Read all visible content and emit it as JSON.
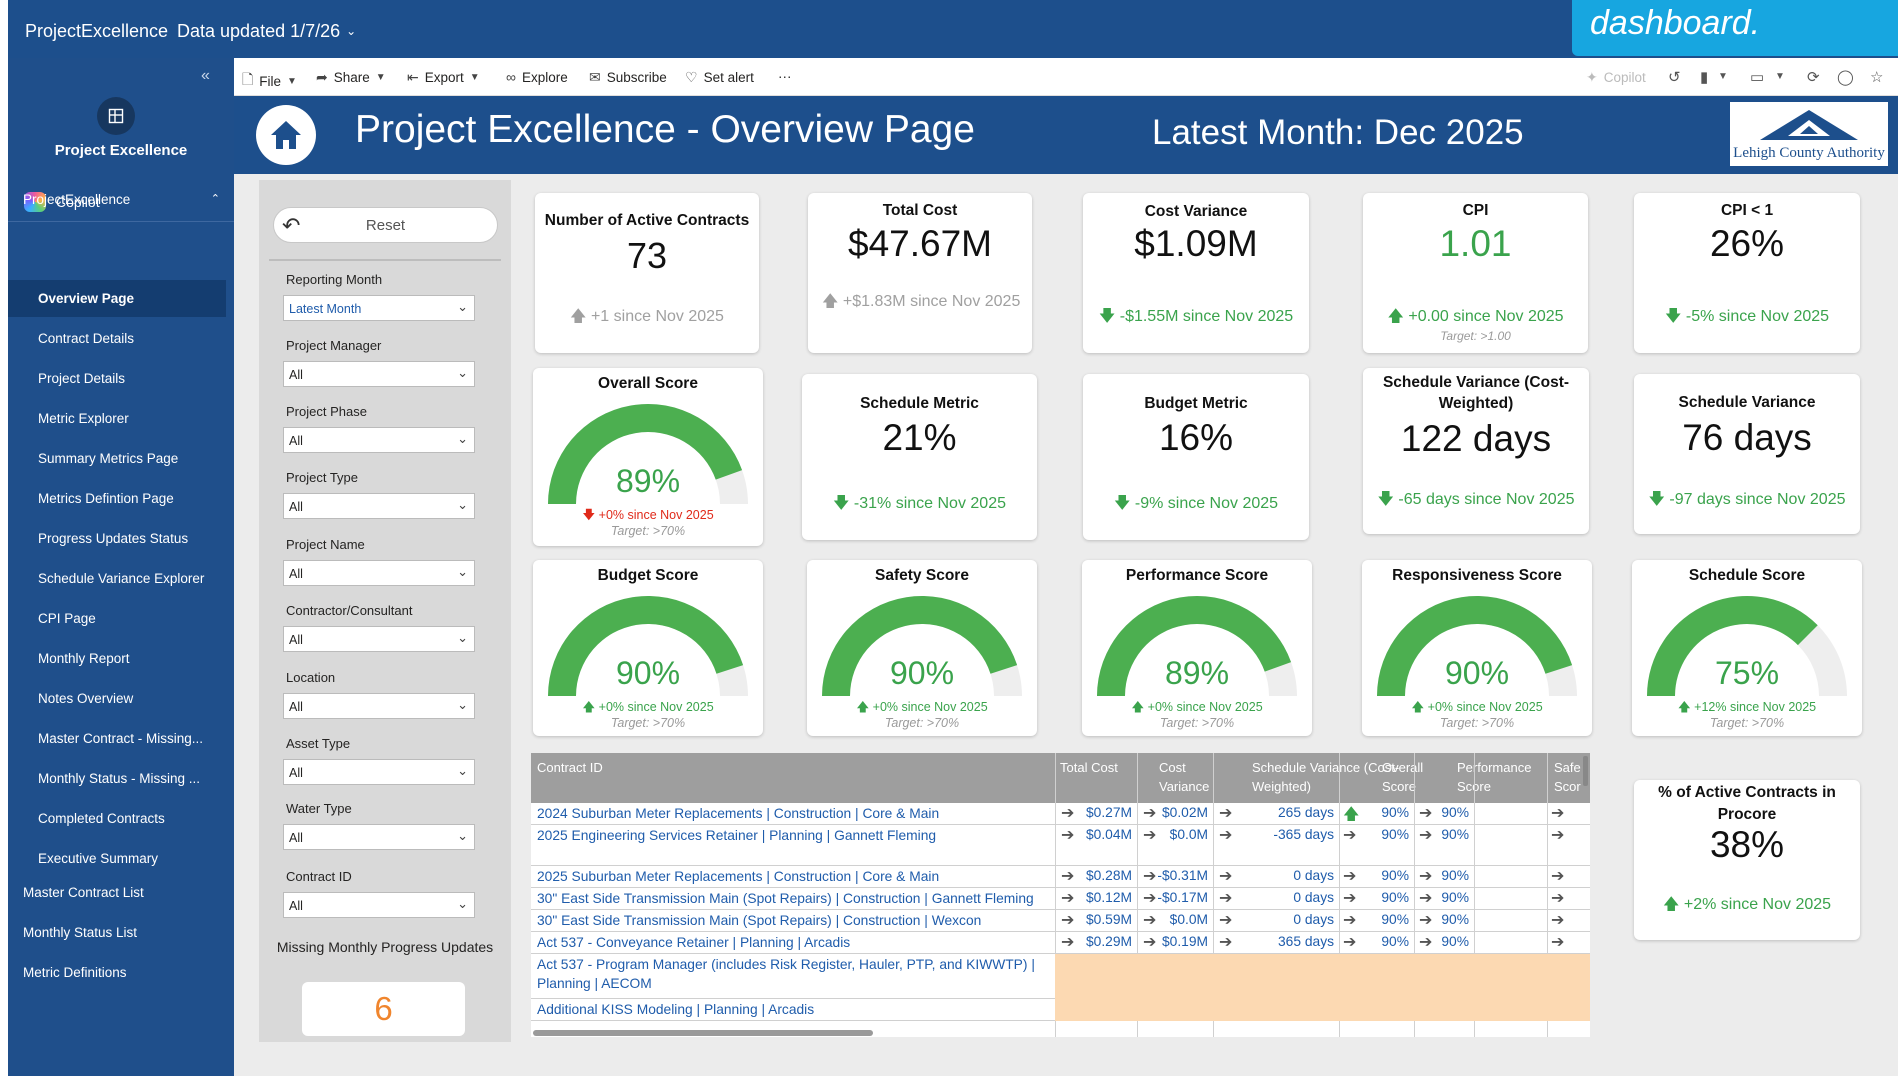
{
  "topbar": {
    "app_name": "ProjectExcellence",
    "data_updated": "Data updated 1/7/26"
  },
  "callout": {
    "text": "dashboard."
  },
  "leftnav": {
    "workspace_name": "Project Excellence",
    "copilot": "Copilot",
    "section": "ProjectExcellence",
    "items": [
      "Overview Page",
      "Contract Details",
      "Project Details",
      "Metric Explorer",
      "Summary Metrics Page",
      "Metrics Defintion Page",
      "Progress Updates Status",
      "Schedule Variance Explorer",
      "CPI Page",
      "Monthly Report",
      "Notes Overview",
      "Master Contract - Missing...",
      "Monthly Status - Missing ...",
      "Completed Contracts",
      "Executive Summary"
    ],
    "active_item": "Overview Page",
    "root_items": [
      "Master Contract List",
      "Monthly Status List",
      "Metric Definitions"
    ]
  },
  "toolbar": {
    "file": "File",
    "share": "Share",
    "export": "Export",
    "explore": "Explore",
    "subscribe": "Subscribe",
    "set_alert": "Set alert",
    "more": "···",
    "copilot": "Copilot"
  },
  "header": {
    "title": "Project Excellence - Overview Page",
    "latest_month": "Latest Month: Dec 2025",
    "logo_text": "Lehigh County Authority"
  },
  "filters": {
    "reset": "Reset",
    "slicers": [
      {
        "label": "Reporting Month",
        "value": "Latest Month"
      },
      {
        "label": "Project Manager",
        "value": "All"
      },
      {
        "label": "Project Phase",
        "value": "All"
      },
      {
        "label": "Project Type",
        "value": "All"
      },
      {
        "label": "Project Name",
        "value": "All"
      },
      {
        "label": "Contractor/Consultant",
        "value": "All"
      },
      {
        "label": "Location",
        "value": "All"
      },
      {
        "label": "Asset Type",
        "value": "All"
      },
      {
        "label": "Water Type",
        "value": "All"
      },
      {
        "label": "Contract ID",
        "value": "All"
      }
    ],
    "missing_label": "Missing Monthly Progress Updates",
    "missing_value": "6"
  },
  "kpis": {
    "active_contracts": {
      "title": "Number of Active Contracts",
      "value": "73",
      "delta": "+1 since Nov 2025"
    },
    "total_cost": {
      "title": "Total Cost",
      "value": "$47.67M",
      "delta": "+$1.83M since Nov 2025"
    },
    "cost_variance": {
      "title": "Cost Variance",
      "value": "$1.09M",
      "delta": "-$1.55M since Nov 2025"
    },
    "cpi": {
      "title": "CPI",
      "value": "1.01",
      "delta": "+0.00 since Nov 2025",
      "target": "Target: >1.00"
    },
    "cpi_lt1": {
      "title": "CPI < 1",
      "value": "26%",
      "delta": "-5% since Nov 2025"
    },
    "schedule_metric": {
      "title": "Schedule Metric",
      "value": "21%",
      "delta": "-31% since Nov 2025"
    },
    "budget_metric": {
      "title": "Budget Metric",
      "value": "16%",
      "delta": "-9% since Nov 2025"
    },
    "sv_cost_weighted": {
      "title": "Schedule Variance (Cost-Weighted)",
      "value": "122 days",
      "delta": "-65 days since Nov 2025"
    },
    "schedule_variance": {
      "title": "Schedule Variance",
      "value": "76 days",
      "delta": "-97 days since Nov 2025"
    },
    "procore": {
      "title": "% of Active Contracts in Procore",
      "value": "38%",
      "delta": "+2% since Nov 2025"
    }
  },
  "gauges": [
    {
      "title": "Overall Score",
      "value": "89%",
      "fill": 0.89,
      "delta": "+0% since Nov 2025",
      "target": "Target: >70%"
    },
    {
      "title": "Budget Score",
      "value": "90%",
      "fill": 0.9,
      "delta": "+0% since Nov 2025",
      "target": "Target: >70%"
    },
    {
      "title": "Safety Score",
      "value": "90%",
      "fill": 0.9,
      "delta": "+0% since Nov 2025",
      "target": "Target: >70%"
    },
    {
      "title": "Performance Score",
      "value": "89%",
      "fill": 0.89,
      "delta": "+0% since Nov 2025",
      "target": "Target: >70%"
    },
    {
      "title": "Responsiveness Score",
      "value": "90%",
      "fill": 0.9,
      "delta": "+0% since Nov 2025",
      "target": "Target: >70%"
    },
    {
      "title": "Schedule Score",
      "value": "75%",
      "fill": 0.75,
      "delta": "+12% since Nov 2025",
      "target": "Target: >70%"
    }
  ],
  "colors": {
    "gauge_fill": "#4caf50",
    "gauge_track": "#eeeeee",
    "good": "#3aa34c",
    "bad": "#e02a1a",
    "header": "#1d4f8c"
  },
  "table": {
    "headers": [
      "Contract ID",
      "Total Cost",
      "Cost Variance",
      "Schedule Variance (Cost-Weighted)",
      "Overall Score",
      "Performance Score",
      "Safe Scor"
    ],
    "rows": [
      {
        "name": "2024 Suburban Meter Replacements | Construction | Core & Main",
        "cost": "$0.27M",
        "cv": "$0.02M",
        "sv": "265 days",
        "os": "90%",
        "ps": "90%"
      },
      {
        "name": "2025 Engineering Services Retainer | Planning | Gannett Fleming",
        "cost": "$0.04M",
        "cv": "$0.0M",
        "sv": "-365 days",
        "os": "90%",
        "ps": "90%"
      },
      {
        "name": "2025 Suburban Meter Replacements | Construction | Core & Main",
        "cost": "$0.28M",
        "cv": "-$0.31M",
        "sv": "0 days",
        "os": "90%",
        "ps": "90%"
      },
      {
        "name": "30\" East Side Transmission Main (Spot Repairs) | Construction | Gannett Fleming",
        "cost": "$0.12M",
        "cv": "-$0.17M",
        "sv": "0 days",
        "os": "90%",
        "ps": "90%"
      },
      {
        "name": "30\" East Side Transmission Main (Spot Repairs) | Construction | Wexcon",
        "cost": "$0.59M",
        "cv": "$0.0M",
        "sv": "0 days",
        "os": "90%",
        "ps": "90%"
      },
      {
        "name": "Act 537 - Conveyance Retainer | Planning | Arcadis",
        "cost": "$0.29M",
        "cv": "$0.19M",
        "sv": "365 days",
        "os": "90%",
        "ps": "90%"
      },
      {
        "name": "Act 537 - Program Manager (includes Risk Register, Hauler, PTP, and KIWWTP) | Planning | AECOM",
        "cost": "",
        "cv": "",
        "sv": "",
        "os": "",
        "ps": ""
      },
      {
        "name": "Additional KISS Modeling | Planning | Arcadis",
        "cost": "",
        "cv": "",
        "sv": "",
        "os": "",
        "ps": ""
      }
    ]
  }
}
